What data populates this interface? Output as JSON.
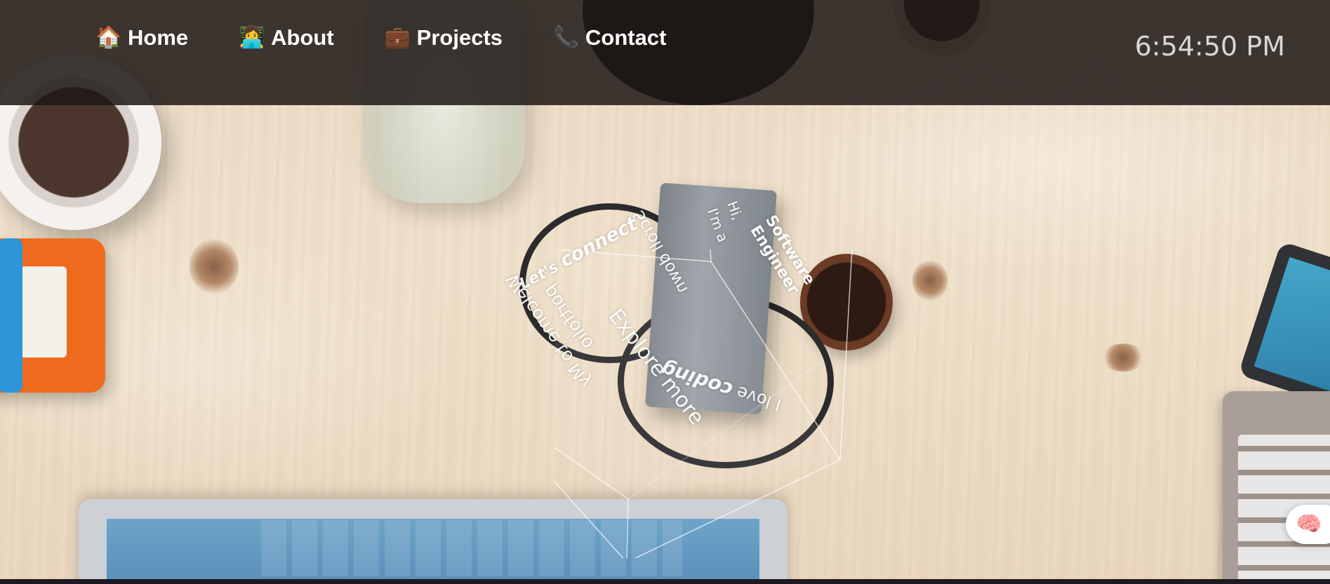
{
  "nav": {
    "items": [
      {
        "label": "Home",
        "icon": "🏠",
        "icon_name": "house-icon"
      },
      {
        "label": "About",
        "icon": "👩‍💻",
        "icon_name": "person-laptop-icon"
      },
      {
        "label": "Projects",
        "icon": "💼",
        "icon_name": "briefcase-icon"
      },
      {
        "label": "Contact",
        "icon": "📞",
        "icon_name": "phone-icon"
      }
    ]
  },
  "clock": "6:54:50 PM",
  "cube": {
    "face_top": "Scroll down",
    "face_connect_a": "Let's",
    "face_connect_b": "connect",
    "face_hi_a": "Hi,",
    "face_hi_b": "I'm a",
    "face_software_a": "Software",
    "face_software_b": "Engineer",
    "face_welcome_a": "Welcome to My",
    "face_welcome_b": "portfolio",
    "face_explore": "Explore more",
    "face_coding_a": "I love",
    "face_coding_b": "coding"
  },
  "brain_button": {
    "icon": "🧠",
    "icon_name": "brain-icon"
  },
  "colors": {
    "nav_bg": "#1e1816",
    "nav_text": "#ffffff",
    "clock_text": "#d9d6d4",
    "desk": "#ecdcc7"
  }
}
